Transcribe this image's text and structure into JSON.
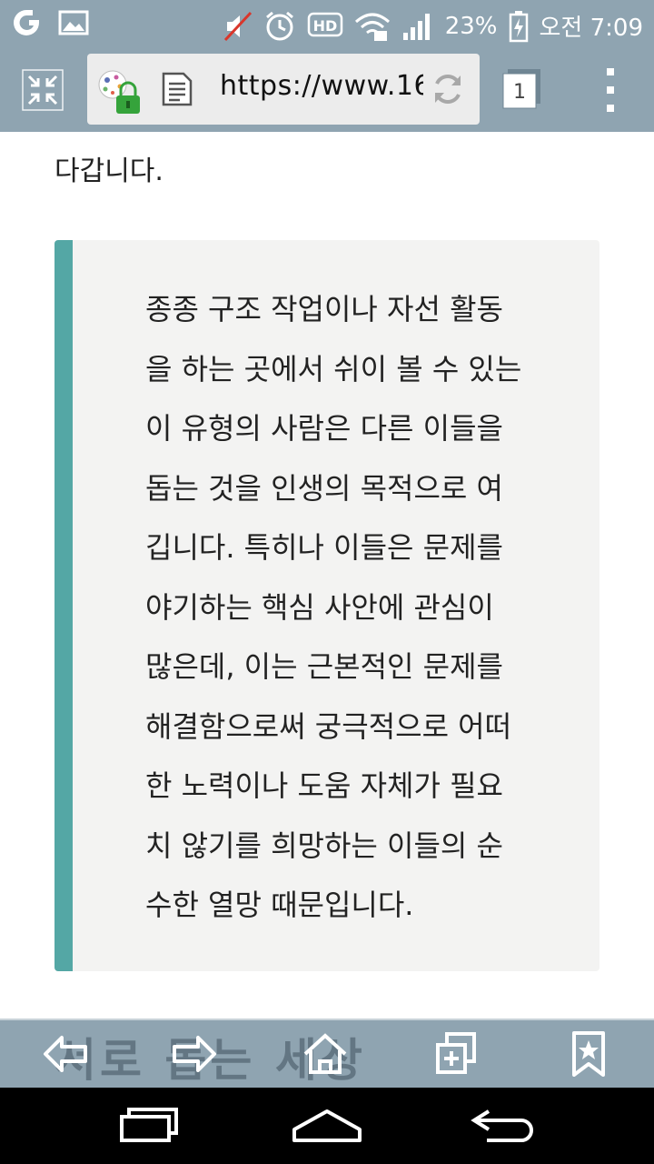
{
  "status_bar": {
    "battery": "23%",
    "time": "오전 7:09",
    "icons": [
      "carrier-icon",
      "gallery-icon",
      "mute-icon",
      "alarm-icon",
      "hd-icon",
      "wifi-icon",
      "signal-icon",
      "battery-icon"
    ]
  },
  "toolbar": {
    "url": "https://www.16",
    "tab_count": "1",
    "icons": [
      "exit-fullscreen-icon",
      "site-favicon-lock-icon",
      "reader-mode-icon",
      "reload-icon",
      "tabs-icon",
      "overflow-menu-icon"
    ]
  },
  "article": {
    "lead_text": "다갑니다.",
    "quote_lines": [
      "종종 구조 작업이나 자선 활동",
      "을 하는 곳에서 쉬이 볼 수 있는",
      "이 유형의 사람은 다른 이들을",
      "돕는 것을 인생의 목적으로 여",
      "깁니다. 특히나 이들은 문제를",
      "야기하는 핵심 사안에 관심이",
      "많은데, 이는 근본적인 문제를",
      "해결함으로써 궁극적으로 어떠",
      "한 노력이나 도움 자체가 필요",
      "치 않기를 희망하는 이들의 순",
      "수한 열망 때문입니다."
    ],
    "accent_color": "#54a7a5"
  },
  "bottom_bar": {
    "ghost_text": "서로 돕는 세상",
    "icons": [
      "back-icon",
      "forward-icon",
      "home-icon",
      "new-tab-icon",
      "bookmark-icon"
    ]
  },
  "nav_bar": {
    "icons": [
      "recent-apps-icon",
      "home-nav-icon",
      "back-nav-icon"
    ]
  }
}
